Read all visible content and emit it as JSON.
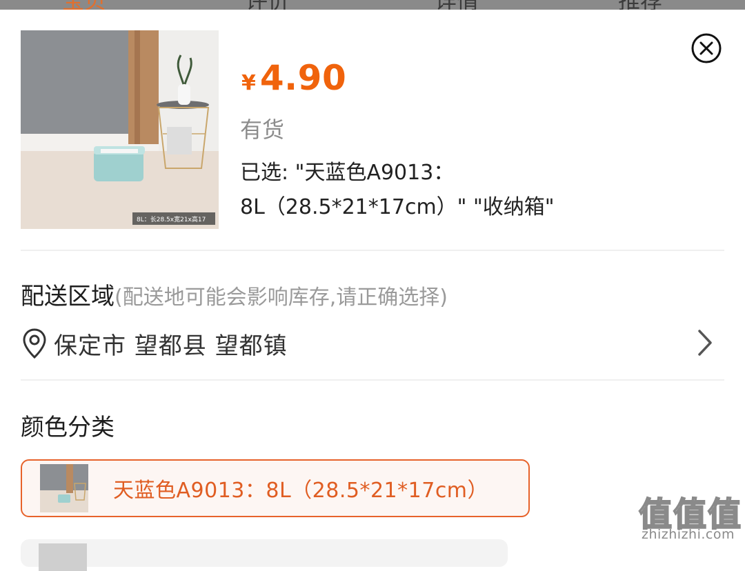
{
  "top_tabs": [
    "宝贝",
    "评价",
    "详情",
    "推荐"
  ],
  "product": {
    "image_caption": "8L：长28.5x宽21x高17",
    "currency_symbol": "¥",
    "price": "4.90",
    "stock_status": "有货",
    "selected_line1": "已选: \"天蓝色A9013：",
    "selected_line2": "8L（28.5*21*17cm）\" \"收纳箱\""
  },
  "delivery": {
    "title": "配送区域",
    "hint": "(配送地可能会影响库存,请正确选择)",
    "location": "保定市 望都县 望都镇"
  },
  "color_section": {
    "title": "颜色分类",
    "options": [
      {
        "label": "天蓝色A9013：8L（28.5*21*17cm）",
        "selected": true
      }
    ]
  },
  "watermark": {
    "glyphs": "值值值",
    "url": "zhizhizhi.com"
  },
  "colors": {
    "accent": "#f0630c",
    "option_border": "#e7622a",
    "muted_text": "#8c8c8c"
  },
  "icons": [
    "close-icon",
    "location-pin-icon",
    "chevron-right-icon"
  ]
}
